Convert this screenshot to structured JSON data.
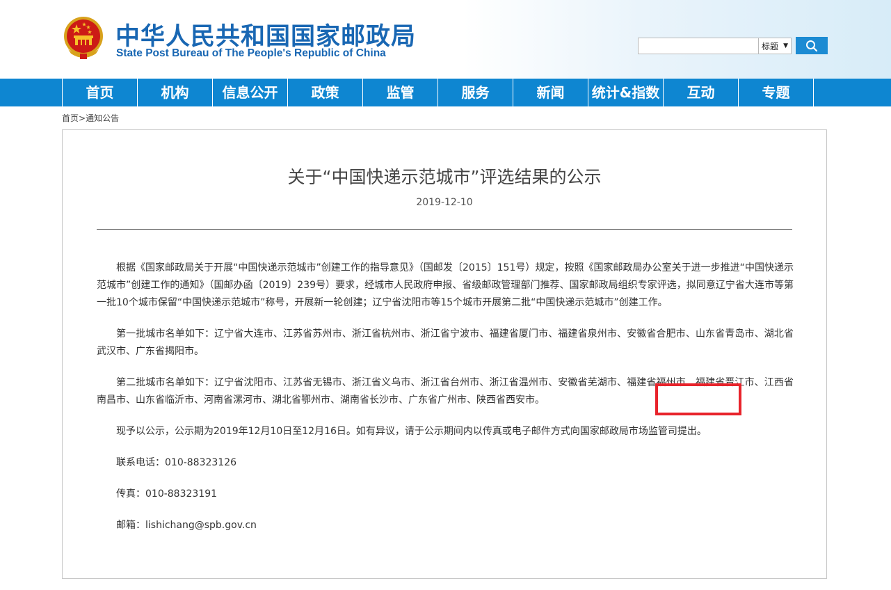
{
  "header": {
    "title_cn": "中华人民共和国国家邮政局",
    "title_en": "State Post Bureau of The People's Republic of China",
    "search": {
      "placeholder": "",
      "scope_selected": "标题",
      "button_icon": "search-icon"
    }
  },
  "colors": {
    "brand_blue": "#1967b3",
    "nav_blue": "#0e86d1",
    "button_blue": "#1c8bd3",
    "highlight_red": "#e8232b"
  },
  "nav": {
    "items": [
      {
        "label": "首页"
      },
      {
        "label": "机构"
      },
      {
        "label": "信息公开"
      },
      {
        "label": "政策"
      },
      {
        "label": "监管"
      },
      {
        "label": "服务"
      },
      {
        "label": "新闻"
      },
      {
        "label": "统计&指数"
      },
      {
        "label": "互动"
      },
      {
        "label": "专题"
      }
    ]
  },
  "breadcrumb": {
    "home": "首页",
    "separator": ">",
    "current": "通知公告"
  },
  "article": {
    "title": "关于“中国快递示范城市”评选结果的公示",
    "date": "2019-12-10",
    "para1": "根据《国家邮政局关于开展“中国快递示范城市”创建工作的指导意见》（国邮发〔2015〕151号）规定，按照《国家邮政局办公室关于进一步推进“中国快递示范城市”创建工作的通知》（国邮办函〔2019〕239号）要求，经城市人民政府申报、省级邮政管理部门推荐、国家邮政局组织专家评选，拟同意辽宁省大连市等第一批10个城市保留“中国快递示范城市”称号，开展新一轮创建；辽宁省沈阳市等15个城市开展第二批“中国快递示范城市”创建工作。",
    "para2": "第一批城市名单如下：辽宁省大连市、江苏省苏州市、浙江省杭州市、浙江省宁波市、福建省厦门市、福建省泉州市、安徽省合肥市、山东省青岛市、湖北省武汉市、广东省揭阳市。",
    "para3_before": "第二批城市名单如下：辽宁省沈阳市、江苏省无锡市、浙江省义乌市、浙江省台州市、浙江省温州市、安徽省芜湖市、",
    "para3_highlight": "福建省福州市、",
    "para3_after": "福建省晋江市、江西省南昌市、山东省临沂市、河南省漯河市、湖北省鄂州市、湖南省长沙市、广东省广州市、陕西省西安市。",
    "para4": "现予以公示，公示期为2019年12月10日至12月16日。如有异议，请于公示期间内以传真或电子邮件方式向国家邮政局市场监管司提出。",
    "phone": "联系电话：010-88323126",
    "fax": "传真：010-88323191",
    "email": "邮箱：lishichang@spb.gov.cn"
  }
}
